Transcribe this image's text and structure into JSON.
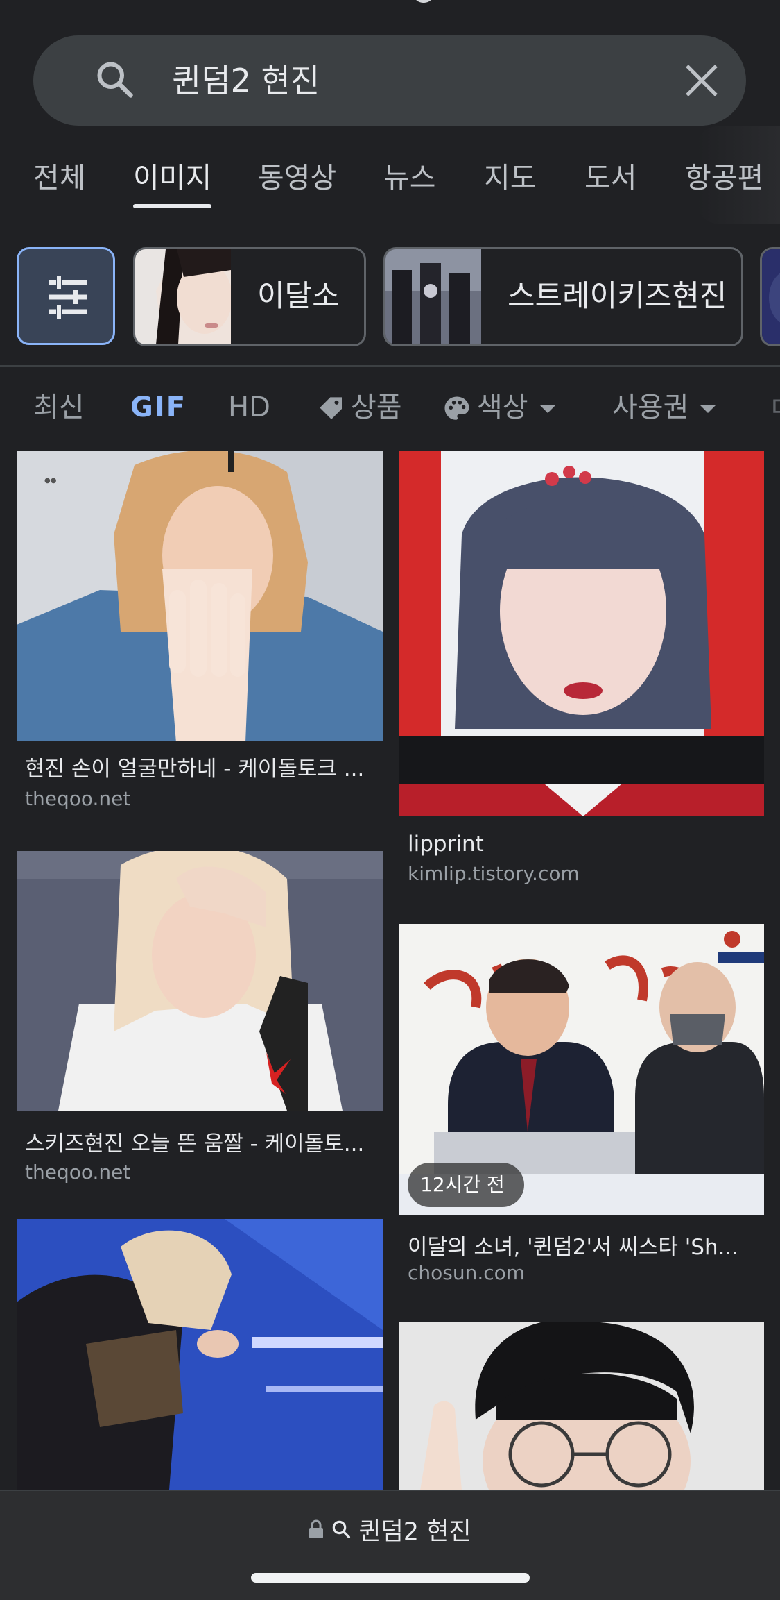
{
  "search": {
    "query": "퀸덤2 현진"
  },
  "tabs": [
    {
      "label": "전체"
    },
    {
      "label": "이미지",
      "active": true
    },
    {
      "label": "동영상"
    },
    {
      "label": "뉴스"
    },
    {
      "label": "지도"
    },
    {
      "label": "도서"
    },
    {
      "label": "항공편"
    }
  ],
  "chips": [
    {
      "label": "이달소"
    },
    {
      "label": "스트레이키즈현진"
    }
  ],
  "filters": [
    {
      "label": "최신"
    },
    {
      "label": "GIF"
    },
    {
      "label": "HD"
    },
    {
      "label": "상품",
      "icon": "tag-icon"
    },
    {
      "label": "색상",
      "icon": "palette-icon"
    },
    {
      "label": "사용권"
    }
  ],
  "results": [
    {
      "title": "현진 손이 얼굴만하네 - 케이돌토크 ...",
      "source": "theqoo.net"
    },
    {
      "title": "lipprint",
      "source": "kimlip.tistory.com"
    },
    {
      "title": "스키즈현진 오늘 뜬 움짤 - 케이돌토...",
      "source": "theqoo.net"
    },
    {
      "title": "이달의 소녀, '퀸덤2'서 씨스타 'Sh...",
      "source": "chosun.com",
      "badge": "12시간 전"
    }
  ],
  "bottom_bar": {
    "url_text": "퀸덤2 현진"
  },
  "colors": {
    "background": "#202124",
    "accent": "#8ab4f8",
    "search_bg": "#3c4043",
    "secondary_text": "#9aa0a6"
  }
}
